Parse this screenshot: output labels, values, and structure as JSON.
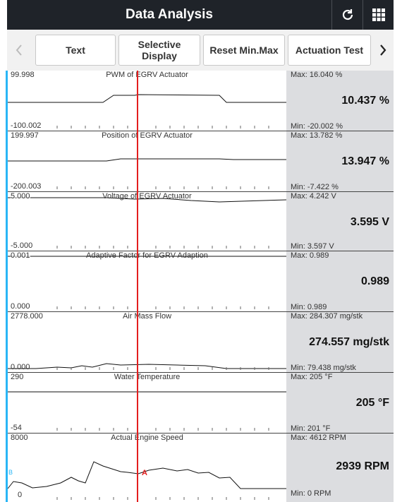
{
  "header": {
    "title": "Data Analysis",
    "refresh_icon": "refresh-icon",
    "grid_icon": "grid-icon"
  },
  "toolbar": {
    "buttons": [
      "Text",
      "Selective Display",
      "Reset Min.Max",
      "Actuation Test"
    ],
    "selective_line1": "Selective",
    "selective_line2": "Display"
  },
  "colors": {
    "header_bg": "#1f2329",
    "cursor": "#e41e1e",
    "value_panel": "#dcdde0",
    "accent": "#29b6f6"
  },
  "panels": [
    {
      "title": "PWM of EGRV Actuator",
      "ymax": "99.998",
      "ymin": "-100.002",
      "max": "Max: 16.040 %",
      "min": "Min: -20.002 %",
      "value": "10.437 %"
    },
    {
      "title": "Position of EGRV Actuator",
      "ymax": "199.997",
      "ymin": "-200.003",
      "max": "Max: 13.782 %",
      "min": "Min: -7.422 %",
      "value": "13.947 %"
    },
    {
      "title": "Voltage of EGRV Actuator",
      "ymax": "5.000",
      "ymin": "-5.000",
      "max": "Max: 4.242 V",
      "min": "Min: 3.597 V",
      "value": "3.595 V"
    },
    {
      "title": "Adaptive Factor for EGRV Adaption",
      "ymax": "0.001",
      "ymin": "0.000",
      "max": "Max: 0.989",
      "min": "Min: 0.989",
      "value": "0.989"
    },
    {
      "title": "Air Mass Flow",
      "ymax": "2778.000",
      "ymin": "0.000",
      "max": "Max: 284.307 mg/stk",
      "min": "Min: 79.438 mg/stk",
      "value": "274.557 mg/stk"
    },
    {
      "title": "Water Temperature",
      "ymax": "290",
      "ymin": "-54",
      "max": "Max: 205 °F",
      "min": "Min: 201 °F",
      "value": "205 °F"
    },
    {
      "title": "Actual Engine Speed",
      "ymax": "8000",
      "ymin": "0",
      "max": "Max: 4612 RPM",
      "min": "Min: 0 RPM",
      "value": "2939 RPM"
    }
  ],
  "markers": {
    "left": "B",
    "cursor": "A"
  }
}
